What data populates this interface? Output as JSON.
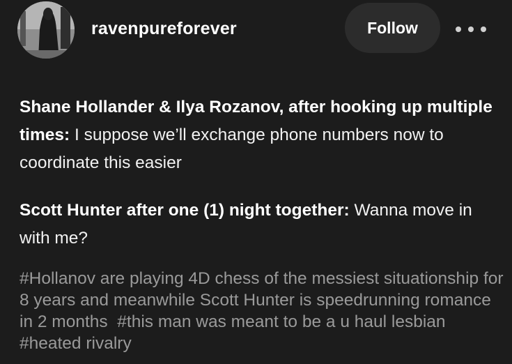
{
  "header": {
    "username": "ravenpureforever",
    "follow_label": "Follow",
    "more_icon": "more-horizontal-icon"
  },
  "post": {
    "paragraphs": [
      {
        "speaker": "Shane Hollander & Ilya Rozanov, after hooking up multiple times:",
        "text": " I suppose we’ll exchange phone numbers now to coordinate this easier"
      },
      {
        "speaker": "Scott Hunter after one (1) night together:",
        "text": " Wanna move in with me?"
      }
    ],
    "tags": [
      "#Hollanov are playing 4D chess of the messiest situationship for 8 years and meanwhile Scott Hunter is speedrunning romance in 2 months",
      "#this man was meant to be a u haul lesbian",
      "#heated rivalry"
    ]
  },
  "colors": {
    "background": "#1c1c1c",
    "button_bg": "#2c2c2c",
    "text": "#ffffff",
    "tag_text": "#9a9a9a"
  }
}
